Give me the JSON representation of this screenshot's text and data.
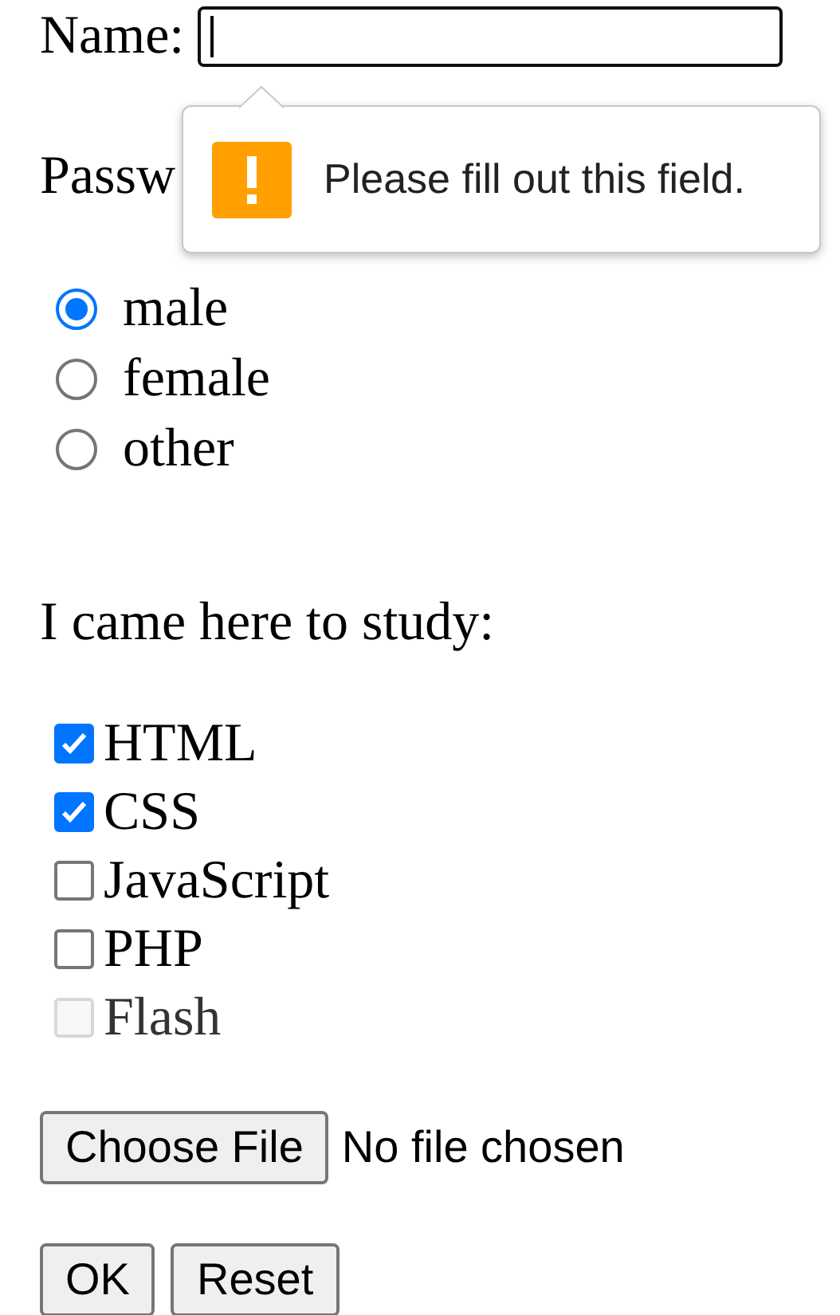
{
  "name_field": {
    "label": "Name:",
    "focused": true
  },
  "password_field": {
    "label": "Passw"
  },
  "validation_tooltip": {
    "message": "Please fill out this field."
  },
  "gender": [
    {
      "label": "male",
      "selected": true
    },
    {
      "label": "female",
      "selected": false
    },
    {
      "label": "other",
      "selected": false
    }
  ],
  "study_prompt": "I came here to study:",
  "subjects": [
    {
      "label": "HTML",
      "checked": true,
      "disabled": false
    },
    {
      "label": "CSS",
      "checked": true,
      "disabled": false
    },
    {
      "label": "JavaScript",
      "checked": false,
      "disabled": false
    },
    {
      "label": "PHP",
      "checked": false,
      "disabled": false
    },
    {
      "label": "Flash",
      "checked": false,
      "disabled": true
    }
  ],
  "file_input": {
    "button": "Choose File",
    "status": "No file chosen"
  },
  "buttons": [
    {
      "label": "OK"
    },
    {
      "label": "Reset"
    }
  ]
}
